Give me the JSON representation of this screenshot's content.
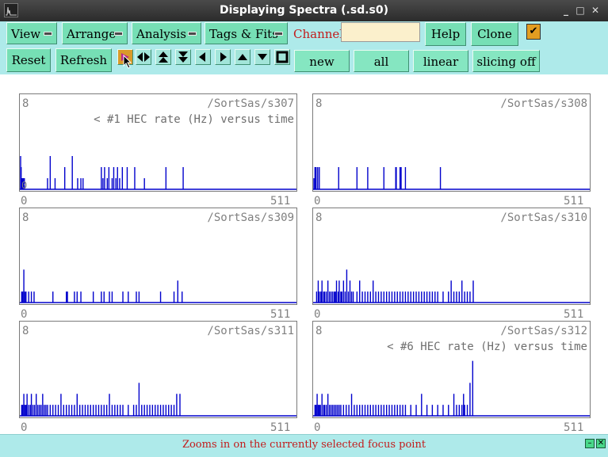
{
  "window": {
    "title": "Displaying Spectra (.sd.s0)",
    "controls": [
      "_",
      "□",
      "✕"
    ]
  },
  "menus": [
    {
      "label": "View"
    },
    {
      "label": "Arrange"
    },
    {
      "label": "Analysis"
    },
    {
      "label": "Tags & Fits"
    }
  ],
  "channel": {
    "label": "Channel:",
    "value": "",
    "placeholder": ""
  },
  "buttons": {
    "help": "Help",
    "clone": "Clone",
    "reset": "Reset",
    "refresh": "Refresh",
    "new": "new",
    "all": "all",
    "linear": "linear",
    "slicing": "slicing off"
  },
  "checkbox_checked": true,
  "nav_icons": [
    "zoom-in-focus-icon",
    "expand-horizontal-icon",
    "expand-vertical-icon",
    "shrink-vertical-icon",
    "scroll-left-icon",
    "scroll-right-icon",
    "scroll-up-icon",
    "scroll-down-icon",
    "full-view-icon"
  ],
  "colors": {
    "trace": "#0000cc",
    "accent_active": "#d99a2a",
    "status_text": "#c21c1c"
  },
  "panels": [
    {
      "name": "/SortSas/s307",
      "ymax": "8",
      "ymin": "0",
      "xmin": "0",
      "xmax": "511",
      "note": "< #1 HEC rate (Hz) versus time",
      "data": [
        [
          0,
          3
        ],
        [
          1,
          2
        ],
        [
          2,
          1
        ],
        [
          3,
          1
        ],
        [
          4,
          1
        ],
        [
          5,
          1
        ],
        [
          6,
          1
        ],
        [
          7,
          1
        ],
        [
          50,
          1
        ],
        [
          55,
          3
        ],
        [
          64,
          1
        ],
        [
          82,
          2
        ],
        [
          96,
          3
        ],
        [
          106,
          1
        ],
        [
          112,
          1
        ],
        [
          116,
          1
        ],
        [
          150,
          2
        ],
        [
          153,
          1
        ],
        [
          156,
          2
        ],
        [
          161,
          1
        ],
        [
          164,
          2
        ],
        [
          170,
          1
        ],
        [
          173,
          2
        ],
        [
          177,
          1
        ],
        [
          180,
          2
        ],
        [
          184,
          1
        ],
        [
          189,
          2
        ],
        [
          198,
          2
        ],
        [
          212,
          2
        ],
        [
          230,
          1
        ],
        [
          270,
          2
        ],
        [
          302,
          2
        ]
      ]
    },
    {
      "name": "/SortSas/s308",
      "ymax": "8",
      "ymin": "",
      "xmin": "0",
      "xmax": "511",
      "note": "",
      "data": [
        [
          0,
          1
        ],
        [
          2,
          2
        ],
        [
          4,
          2
        ],
        [
          7,
          2
        ],
        [
          10,
          2
        ],
        [
          46,
          2
        ],
        [
          80,
          2
        ],
        [
          100,
          2
        ],
        [
          130,
          2
        ],
        [
          152,
          2
        ],
        [
          153,
          2
        ],
        [
          160,
          2
        ],
        [
          162,
          2
        ],
        [
          170,
          2
        ],
        [
          235,
          2
        ]
      ]
    },
    {
      "name": "/SortSas/s309",
      "ymax": "8",
      "ymin": "",
      "xmin": "0",
      "xmax": "511",
      "note": "",
      "data": [
        [
          2,
          1
        ],
        [
          4,
          1
        ],
        [
          6,
          3
        ],
        [
          8,
          1
        ],
        [
          10,
          1
        ],
        [
          15,
          1
        ],
        [
          20,
          1
        ],
        [
          25,
          1
        ],
        [
          60,
          1
        ],
        [
          85,
          1
        ],
        [
          87,
          1
        ],
        [
          100,
          1
        ],
        [
          105,
          1
        ],
        [
          112,
          1
        ],
        [
          135,
          1
        ],
        [
          150,
          1
        ],
        [
          155,
          1
        ],
        [
          165,
          1
        ],
        [
          170,
          1
        ],
        [
          190,
          1
        ],
        [
          200,
          1
        ],
        [
          215,
          1
        ],
        [
          220,
          1
        ],
        [
          260,
          1
        ],
        [
          285,
          1
        ],
        [
          292,
          2
        ],
        [
          300,
          1
        ]
      ]
    },
    {
      "name": "/SortSas/s310",
      "ymax": "8",
      "ymin": "",
      "xmin": "0",
      "xmax": "511",
      "note": "",
      "data": [
        [
          5,
          1
        ],
        [
          8,
          2
        ],
        [
          10,
          1
        ],
        [
          13,
          1
        ],
        [
          15,
          2
        ],
        [
          18,
          1
        ],
        [
          20,
          1
        ],
        [
          23,
          1
        ],
        [
          26,
          2
        ],
        [
          29,
          1
        ],
        [
          32,
          1
        ],
        [
          35,
          1
        ],
        [
          38,
          1
        ],
        [
          40,
          1
        ],
        [
          42,
          2
        ],
        [
          45,
          1
        ],
        [
          47,
          2
        ],
        [
          50,
          1
        ],
        [
          52,
          1
        ],
        [
          55,
          2
        ],
        [
          58,
          1
        ],
        [
          61,
          3
        ],
        [
          64,
          1
        ],
        [
          67,
          2
        ],
        [
          70,
          1
        ],
        [
          73,
          1
        ],
        [
          80,
          1
        ],
        [
          85,
          2
        ],
        [
          90,
          1
        ],
        [
          95,
          1
        ],
        [
          100,
          1
        ],
        [
          105,
          1
        ],
        [
          110,
          2
        ],
        [
          115,
          1
        ],
        [
          120,
          1
        ],
        [
          125,
          1
        ],
        [
          130,
          1
        ],
        [
          135,
          1
        ],
        [
          140,
          1
        ],
        [
          145,
          1
        ],
        [
          150,
          1
        ],
        [
          155,
          1
        ],
        [
          160,
          1
        ],
        [
          165,
          1
        ],
        [
          170,
          1
        ],
        [
          175,
          1
        ],
        [
          180,
          1
        ],
        [
          185,
          1
        ],
        [
          190,
          1
        ],
        [
          195,
          1
        ],
        [
          200,
          1
        ],
        [
          205,
          1
        ],
        [
          210,
          1
        ],
        [
          215,
          1
        ],
        [
          220,
          1
        ],
        [
          225,
          1
        ],
        [
          230,
          1
        ],
        [
          240,
          1
        ],
        [
          250,
          1
        ],
        [
          255,
          2
        ],
        [
          260,
          1
        ],
        [
          265,
          1
        ],
        [
          270,
          1
        ],
        [
          275,
          2
        ],
        [
          280,
          1
        ],
        [
          285,
          1
        ],
        [
          290,
          1
        ],
        [
          296,
          2
        ]
      ]
    },
    {
      "name": "/SortSas/s311",
      "ymax": "8",
      "ymin": "",
      "xmin": "0",
      "xmax": "511",
      "note": "",
      "data": [
        [
          2,
          1
        ],
        [
          4,
          1
        ],
        [
          6,
          2
        ],
        [
          8,
          1
        ],
        [
          10,
          1
        ],
        [
          12,
          2
        ],
        [
          15,
          1
        ],
        [
          18,
          1
        ],
        [
          20,
          2
        ],
        [
          23,
          1
        ],
        [
          26,
          1
        ],
        [
          29,
          2
        ],
        [
          32,
          1
        ],
        [
          35,
          1
        ],
        [
          38,
          1
        ],
        [
          41,
          2
        ],
        [
          44,
          1
        ],
        [
          47,
          1
        ],
        [
          50,
          1
        ],
        [
          55,
          1
        ],
        [
          60,
          1
        ],
        [
          65,
          1
        ],
        [
          70,
          1
        ],
        [
          75,
          2
        ],
        [
          80,
          1
        ],
        [
          85,
          1
        ],
        [
          90,
          1
        ],
        [
          95,
          1
        ],
        [
          100,
          1
        ],
        [
          105,
          2
        ],
        [
          110,
          1
        ],
        [
          115,
          1
        ],
        [
          120,
          1
        ],
        [
          125,
          1
        ],
        [
          130,
          1
        ],
        [
          135,
          1
        ],
        [
          140,
          1
        ],
        [
          145,
          1
        ],
        [
          150,
          1
        ],
        [
          155,
          1
        ],
        [
          160,
          1
        ],
        [
          165,
          2
        ],
        [
          170,
          1
        ],
        [
          175,
          1
        ],
        [
          180,
          1
        ],
        [
          185,
          1
        ],
        [
          190,
          1
        ],
        [
          200,
          1
        ],
        [
          210,
          1
        ],
        [
          215,
          1
        ],
        [
          220,
          3
        ],
        [
          225,
          1
        ],
        [
          230,
          1
        ],
        [
          235,
          1
        ],
        [
          240,
          1
        ],
        [
          245,
          1
        ],
        [
          250,
          1
        ],
        [
          255,
          1
        ],
        [
          260,
          1
        ],
        [
          265,
          1
        ],
        [
          270,
          1
        ],
        [
          275,
          1
        ],
        [
          280,
          1
        ],
        [
          285,
          1
        ],
        [
          290,
          2
        ],
        [
          296,
          2
        ]
      ]
    },
    {
      "name": "/SortSas/s312",
      "ymax": "8",
      "ymin": "",
      "xmin": "0",
      "xmax": "511",
      "note": "< #6 HEC rate (Hz) versus time",
      "data": [
        [
          2,
          1
        ],
        [
          4,
          1
        ],
        [
          6,
          2
        ],
        [
          8,
          1
        ],
        [
          10,
          1
        ],
        [
          12,
          1
        ],
        [
          15,
          2
        ],
        [
          18,
          1
        ],
        [
          20,
          1
        ],
        [
          23,
          1
        ],
        [
          26,
          2
        ],
        [
          29,
          1
        ],
        [
          32,
          1
        ],
        [
          35,
          1
        ],
        [
          38,
          1
        ],
        [
          41,
          1
        ],
        [
          44,
          1
        ],
        [
          47,
          1
        ],
        [
          50,
          1
        ],
        [
          55,
          1
        ],
        [
          60,
          1
        ],
        [
          65,
          1
        ],
        [
          70,
          2
        ],
        [
          75,
          1
        ],
        [
          80,
          1
        ],
        [
          85,
          1
        ],
        [
          90,
          1
        ],
        [
          95,
          1
        ],
        [
          100,
          1
        ],
        [
          105,
          1
        ],
        [
          110,
          1
        ],
        [
          115,
          1
        ],
        [
          120,
          1
        ],
        [
          125,
          1
        ],
        [
          130,
          1
        ],
        [
          135,
          1
        ],
        [
          140,
          1
        ],
        [
          145,
          1
        ],
        [
          150,
          1
        ],
        [
          155,
          1
        ],
        [
          160,
          1
        ],
        [
          165,
          1
        ],
        [
          170,
          1
        ],
        [
          180,
          1
        ],
        [
          190,
          1
        ],
        [
          200,
          2
        ],
        [
          210,
          1
        ],
        [
          220,
          1
        ],
        [
          230,
          1
        ],
        [
          240,
          1
        ],
        [
          250,
          1
        ],
        [
          260,
          2
        ],
        [
          265,
          1
        ],
        [
          270,
          1
        ],
        [
          275,
          1
        ],
        [
          278,
          2
        ],
        [
          280,
          1
        ],
        [
          285,
          1
        ],
        [
          290,
          3
        ],
        [
          295,
          5
        ]
      ]
    }
  ],
  "status": {
    "text": "Zooms in on the currently selected focus point"
  }
}
